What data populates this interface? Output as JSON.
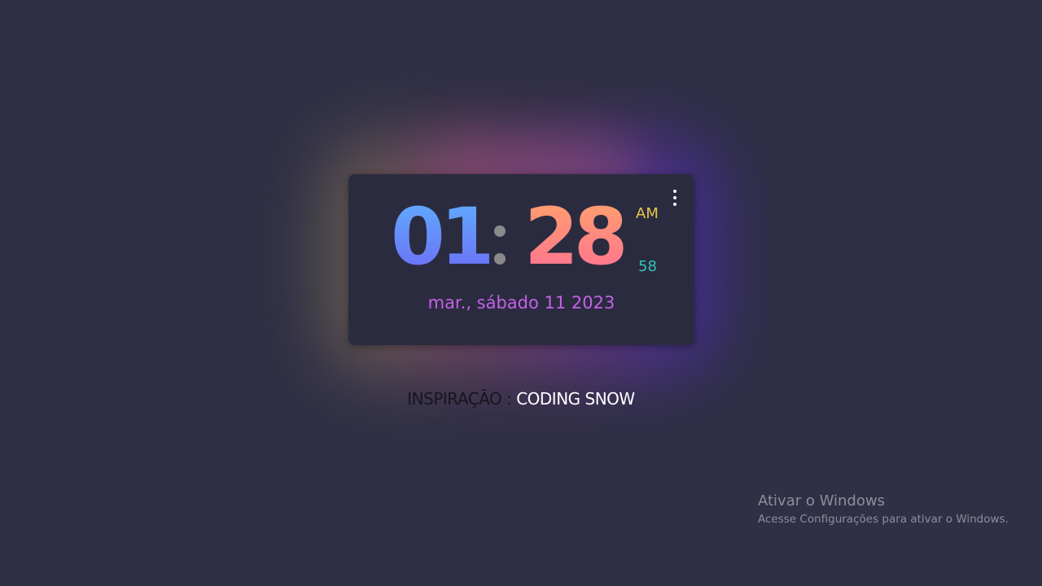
{
  "clock": {
    "hours": "01",
    "minutes": "28",
    "ampm": "AM",
    "seconds": "58",
    "date": "mar., sábado 11 2023",
    "menu_icon": "more-vertical-icon"
  },
  "credit": {
    "label": "INSPIRAÇÃO : ",
    "author": "CODING SNOW"
  },
  "windows_watermark": {
    "title": "Ativar o Windows",
    "subtitle": "Acesse Configurações para ativar o Windows."
  },
  "colors": {
    "background": "#2f2f45",
    "card": "#2b2b40",
    "hours_gradient": [
      "#5fb2ff",
      "#6d68f5"
    ],
    "minutes_gradient": [
      "#ffa46a",
      "#ff6f95"
    ],
    "ampm": "#e8c548",
    "seconds": "#2fc5b4",
    "date": "#c561e8"
  }
}
